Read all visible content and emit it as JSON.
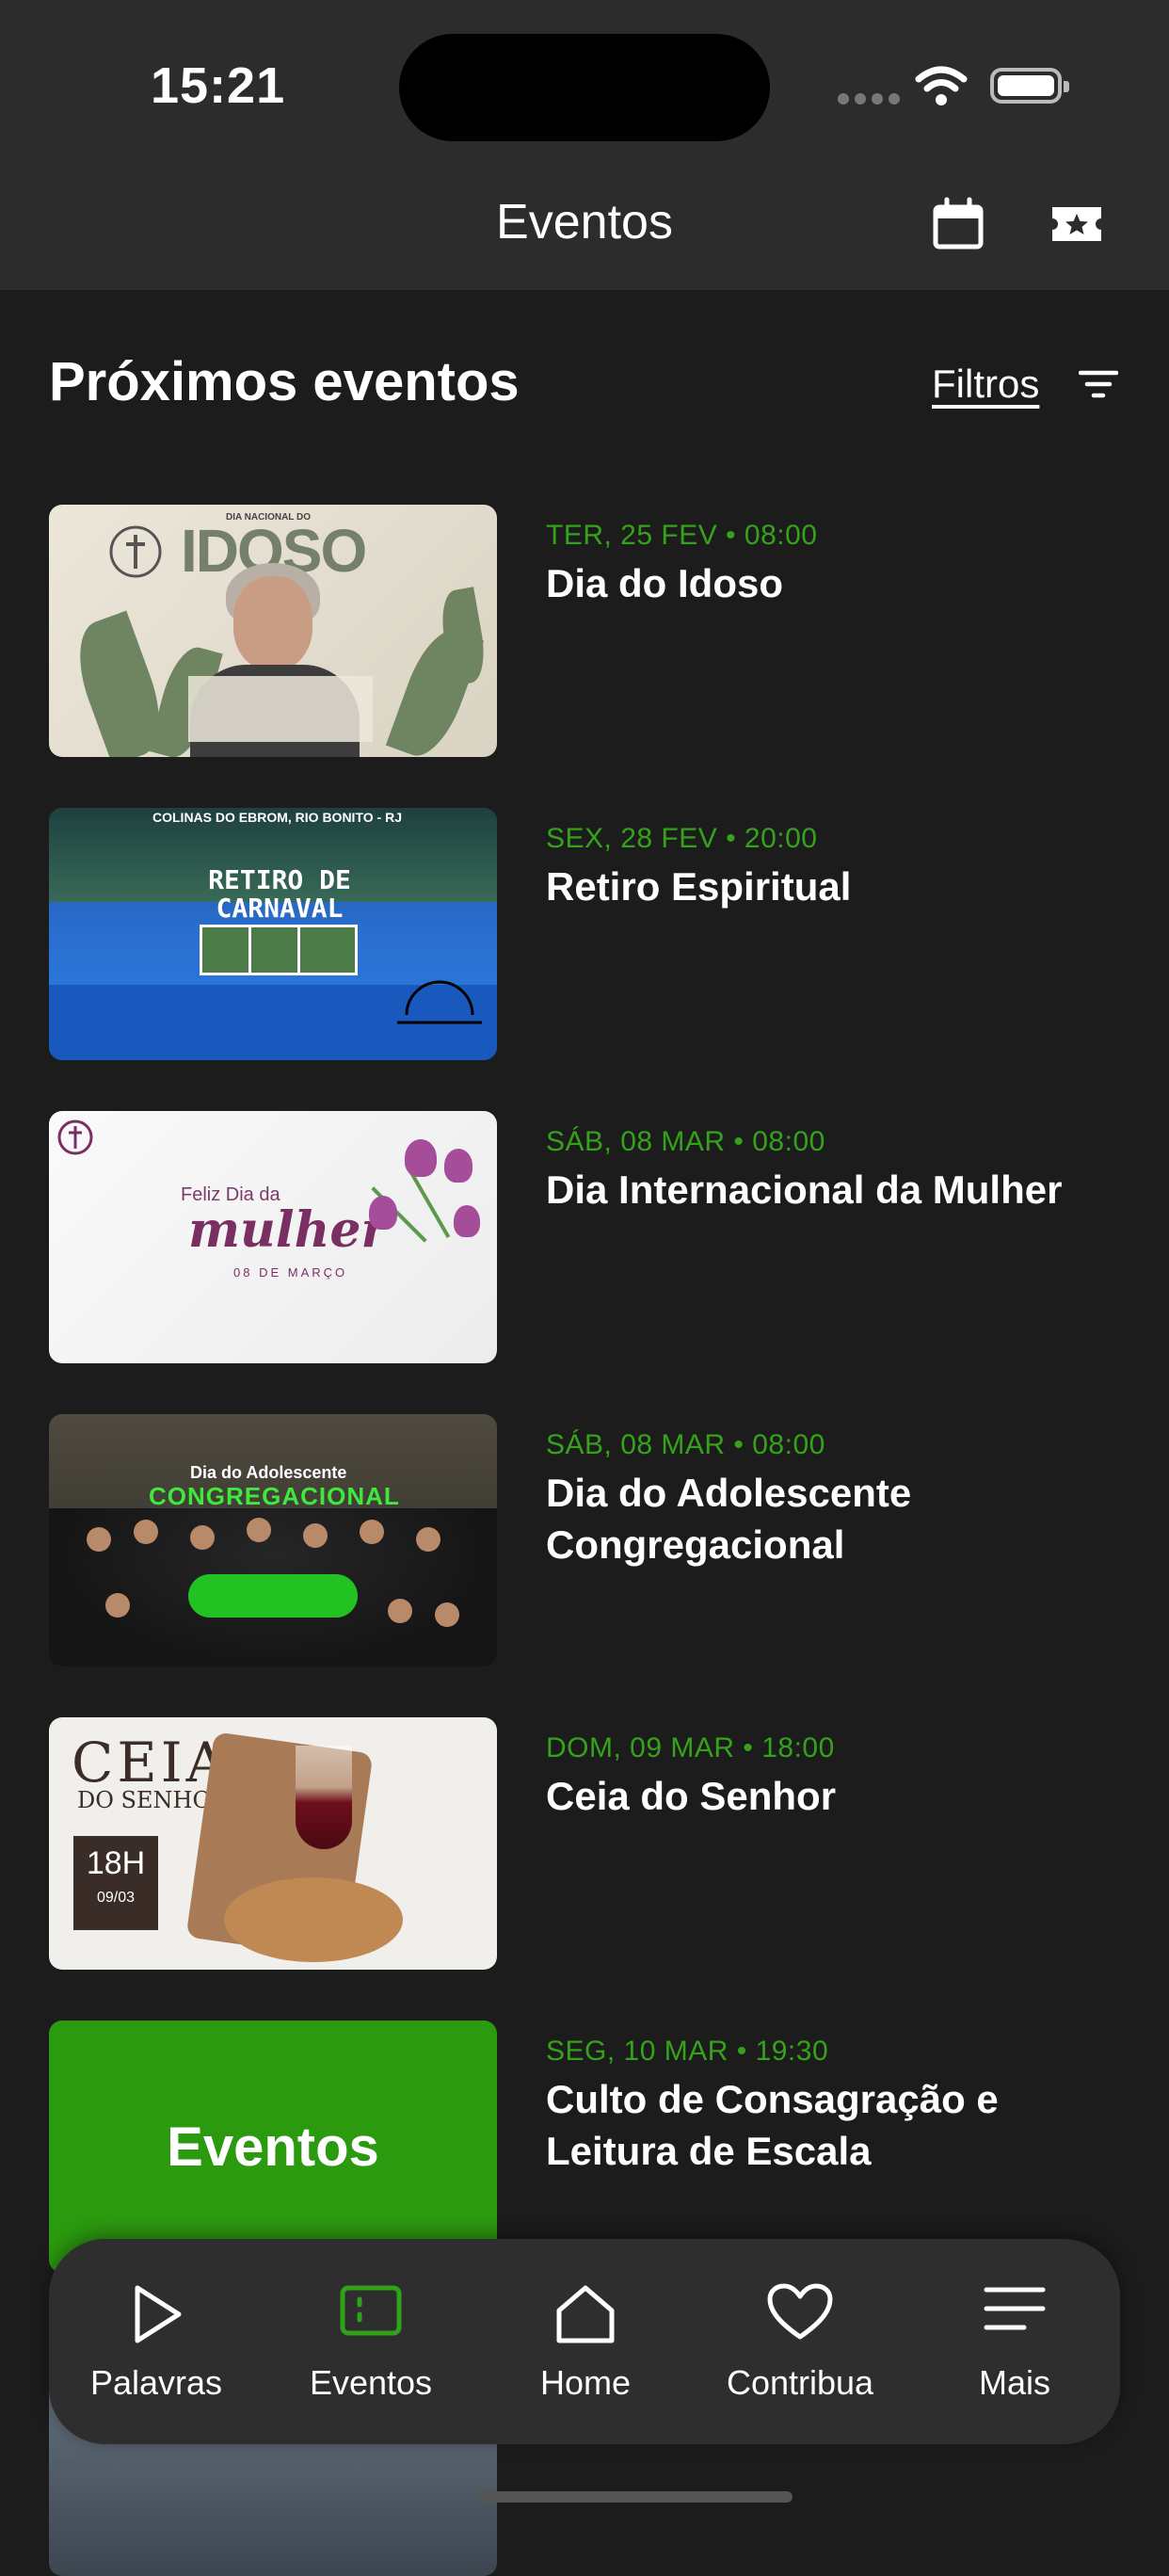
{
  "status_bar": {
    "time": "15:21"
  },
  "header": {
    "title": "Eventos",
    "calendar_icon": "calendar-icon",
    "ticket_icon": "ticket-star-icon"
  },
  "section": {
    "title": "Próximos eventos",
    "filters_label": "Filtros",
    "filter_icon": "filter-lines-icon"
  },
  "events": [
    {
      "date": "TER, 25 FEV • 08:00",
      "title": "Dia do Idoso",
      "thumb": {
        "banner": "IDOSO",
        "tagline": "DIA NACIONAL DO"
      }
    },
    {
      "date": "SEX, 28 FEV • 20:00",
      "title": "Retiro Espiritual",
      "thumb": {
        "banner": "RETIRO DE CARNAVAL 2025",
        "location": "COLINAS DO EBROM, RIO BONITO - RJ"
      }
    },
    {
      "date": "SÁB, 08 MAR • 08:00",
      "title": "Dia Internacional da Mulher",
      "thumb": {
        "feliz": "Feliz Dia da",
        "banner": "mulher",
        "date_text": "08 DE MARÇO"
      }
    },
    {
      "date": "SÁB, 08 MAR • 08:00",
      "title": "Dia do Adolescente Congregacional",
      "thumb": {
        "line1": "Dia do Adolescente",
        "line2": "CONGREGACIONAL"
      }
    },
    {
      "date": "DOM, 09 MAR • 18:00",
      "title": "Ceia do Senhor",
      "thumb": {
        "banner": "CEIA",
        "sub": "DO SENHOR",
        "time": "18H",
        "day": "09/03"
      }
    },
    {
      "date": "SEG, 10 MAR • 19:30",
      "title": "Culto de Consagração e Leitura de Escala",
      "thumb": {
        "banner": "Eventos"
      }
    }
  ],
  "tabbar": {
    "items": [
      {
        "label": "Palavras",
        "icon": "play-icon",
        "active": false
      },
      {
        "label": "Eventos",
        "icon": "event-ticket-icon",
        "active": true
      },
      {
        "label": "Home",
        "icon": "home-icon",
        "active": false
      },
      {
        "label": "Contribua",
        "icon": "heart-icon",
        "active": false
      },
      {
        "label": "Mais",
        "icon": "menu-icon",
        "active": false
      }
    ],
    "active_color": "#2fa11a"
  },
  "colors": {
    "accent": "#35a31a",
    "background": "#1c1c1c",
    "header_bg": "#2c2c2c"
  }
}
